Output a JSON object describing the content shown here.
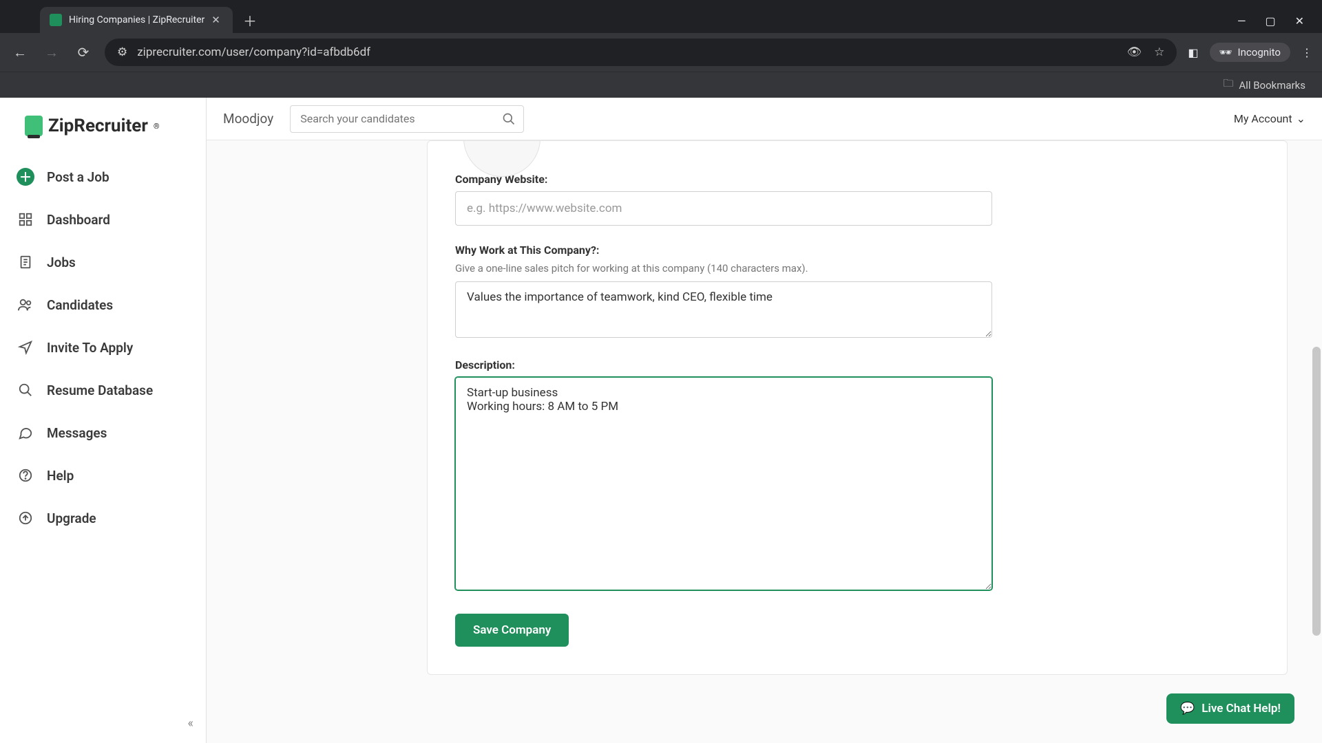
{
  "browser": {
    "tab_title": "Hiring Companies | ZipRecruiter",
    "url": "ziprecruiter.com/user/company?id=afbdb6df",
    "incognito_label": "Incognito",
    "all_bookmarks": "All Bookmarks"
  },
  "brand": {
    "name": "ZipRecruiter"
  },
  "sidebar": {
    "items": [
      {
        "label": "Post a Job"
      },
      {
        "label": "Dashboard"
      },
      {
        "label": "Jobs"
      },
      {
        "label": "Candidates"
      },
      {
        "label": "Invite To Apply"
      },
      {
        "label": "Resume Database"
      },
      {
        "label": "Messages"
      },
      {
        "label": "Help"
      },
      {
        "label": "Upgrade"
      }
    ]
  },
  "topbar": {
    "breadcrumb": "Moodjoy",
    "search_placeholder": "Search your candidates",
    "account_label": "My Account"
  },
  "form": {
    "website": {
      "label": "Company Website:",
      "placeholder": "e.g. https://www.website.com",
      "value": ""
    },
    "why": {
      "label": "Why Work at This Company?:",
      "hint": "Give a one-line sales pitch for working at this company (140 characters max).",
      "value": "Values the importance of teamwork, kind CEO, flexible time"
    },
    "description": {
      "label": "Description:",
      "value": "Start-up business\nWorking hours: 8 AM to 5 PM"
    },
    "save_label": "Save Company"
  },
  "chat": {
    "label": "Live Chat Help!"
  }
}
